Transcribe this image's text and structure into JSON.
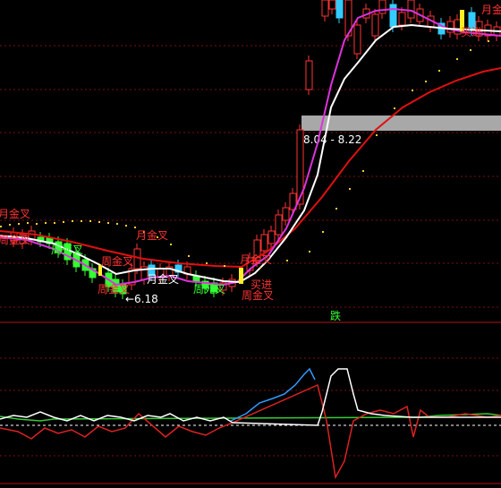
{
  "chart_data": [
    {
      "type": "candlestick",
      "title": "",
      "annotations": {
        "resistance_band": "8.04 - 8.22",
        "low_marker": "←6.18",
        "signals": [
          {
            "text": "月金叉",
            "color": "#ff3333"
          },
          {
            "text": "月金叉",
            "color": "#ff3333"
          },
          {
            "text": "月金叉",
            "color": "#ffffff"
          },
          {
            "text": "周金叉",
            "color": "#ff3333"
          },
          {
            "text": "周死叉",
            "color": "#33ff33"
          },
          {
            "text": "周死叉",
            "color": "#33ff33"
          },
          {
            "text": "周金叉",
            "color": "#ff3333"
          },
          {
            "text": "周金叉",
            "color": "#ff3333"
          },
          {
            "text": "月金叉",
            "color": "#ff3333"
          },
          {
            "text": "买进",
            "color": "#ff3333"
          },
          {
            "text": "周金叉",
            "color": "#ff3333"
          },
          {
            "text": "金叉",
            "color": "#ff3333"
          },
          {
            "text": "月金",
            "color": "#ff3333"
          },
          {
            "text": "买进",
            "color": "#ff3333"
          }
        ]
      },
      "series": [
        {
          "style": "candles",
          "color_up": "#ff3333",
          "color_down": "#33ff33",
          "color_alt": "#33ccff"
        },
        {
          "style": "line",
          "color": "#ffffff"
        },
        {
          "style": "line",
          "color": "#dd33dd"
        },
        {
          "style": "line",
          "color": "#e01010"
        },
        {
          "style": "dotted",
          "color": "#ffcc33"
        }
      ]
    },
    {
      "type": "line",
      "annotations": {
        "label": "跌"
      },
      "series": [
        {
          "style": "line",
          "color": "#ffffff"
        },
        {
          "style": "line",
          "color": "#dd2222"
        },
        {
          "style": "line",
          "color": "#3399ff"
        },
        {
          "style": "line",
          "color": "#33cc33"
        }
      ],
      "reference_line": 0
    }
  ]
}
